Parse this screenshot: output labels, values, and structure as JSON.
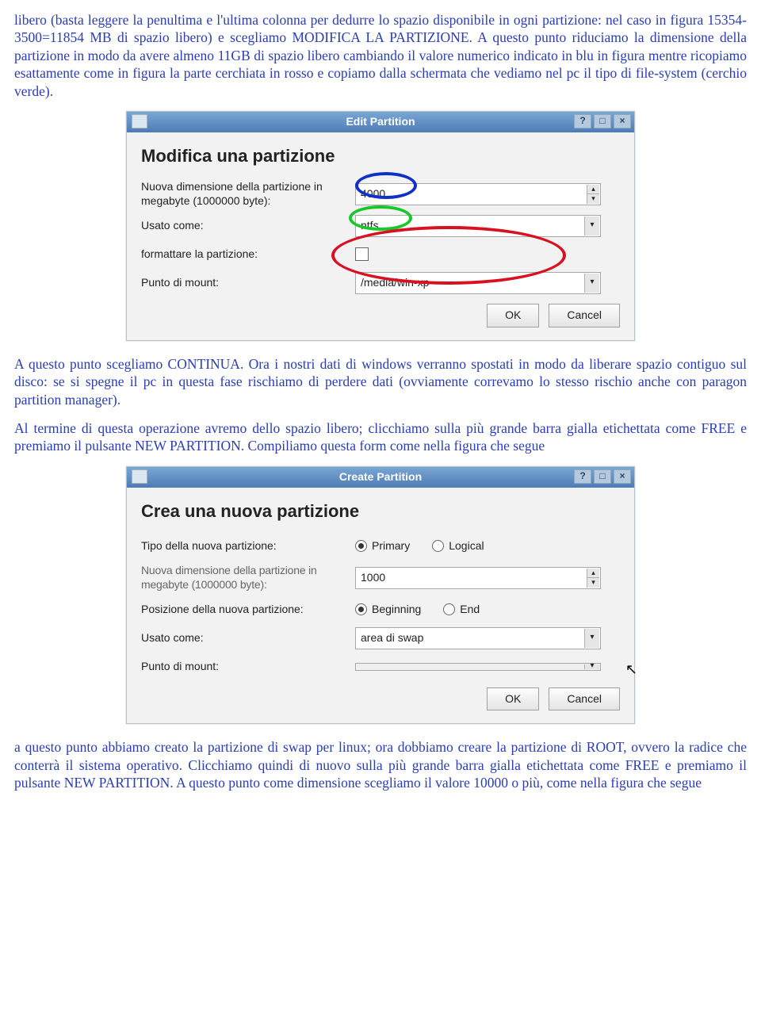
{
  "paragraphs": {
    "p1": "libero (basta leggere la penultima e l'ultima colonna per dedurre lo spazio disponibile in ogni partizione: nel caso in figura 15354-3500=11854 MB di spazio libero) e scegliamo MODIFICA LA PARTIZIONE. A questo punto riduciamo la dimensione della partizione in modo da avere almeno 11GB di spazio libero cambiando il valore numerico indicato in blu in figura mentre ricopiamo esattamente come in figura la parte cerchiata in rosso e copiamo dalla schermata che vediamo nel pc il tipo di file-system (cerchio verde).",
    "p2": "A questo punto scegliamo CONTINUA. Ora i nostri dati di windows verranno spostati in modo da liberare spazio contiguo sul disco: se si spegne il pc in questa fase rischiamo di perdere dati (ovviamente correvamo lo stesso rischio anche con paragon partition manager).",
    "p3": "Al termine di questa operazione avremo dello spazio libero; clicchiamo sulla più grande barra gialla etichettata come FREE e premiamo il pulsante NEW PARTITION. Compiliamo questa form come nella figura che segue",
    "p4": "a questo punto abbiamo creato la partizione di swap per linux; ora dobbiamo creare la partizione di ROOT, ovvero la radice che conterrà il sistema operativo. Clicchiamo quindi di nuovo sulla più grande barra gialla etichettata come FREE e premiamo il pulsante NEW PARTITION. A questo punto come dimensione scegliamo il valore 10000 o più, come nella figura che segue"
  },
  "dialog1": {
    "title": "Edit Partition",
    "heading": "Modifica una partizione",
    "label_size": "Nuova dimensione della partizione in megabyte (1000000 byte):",
    "value_size": "4000",
    "label_useas": "Usato come:",
    "value_useas": "ntfs",
    "label_format": "formattare la partizione:",
    "label_mount": "Punto di mount:",
    "value_mount": "/media/win-xp",
    "btn_ok": "OK",
    "btn_cancel": "Cancel"
  },
  "dialog2": {
    "title": "Create Partition",
    "heading": "Crea una nuova partizione",
    "label_type": "Tipo della nuova partizione:",
    "radio_primary": "Primary",
    "radio_logical": "Logical",
    "label_size": "Nuova dimensione della partizione in megabyte (1000000 byte):",
    "value_size": "1000",
    "label_position": "Posizione della nuova partizione:",
    "radio_begin": "Beginning",
    "radio_end": "End",
    "label_useas": "Usato come:",
    "value_useas": "area di swap",
    "label_mount": "Punto di mount:",
    "value_mount": "",
    "btn_ok": "OK",
    "btn_cancel": "Cancel"
  },
  "winbuttons": {
    "help": "?",
    "max": "□",
    "close": "×"
  }
}
